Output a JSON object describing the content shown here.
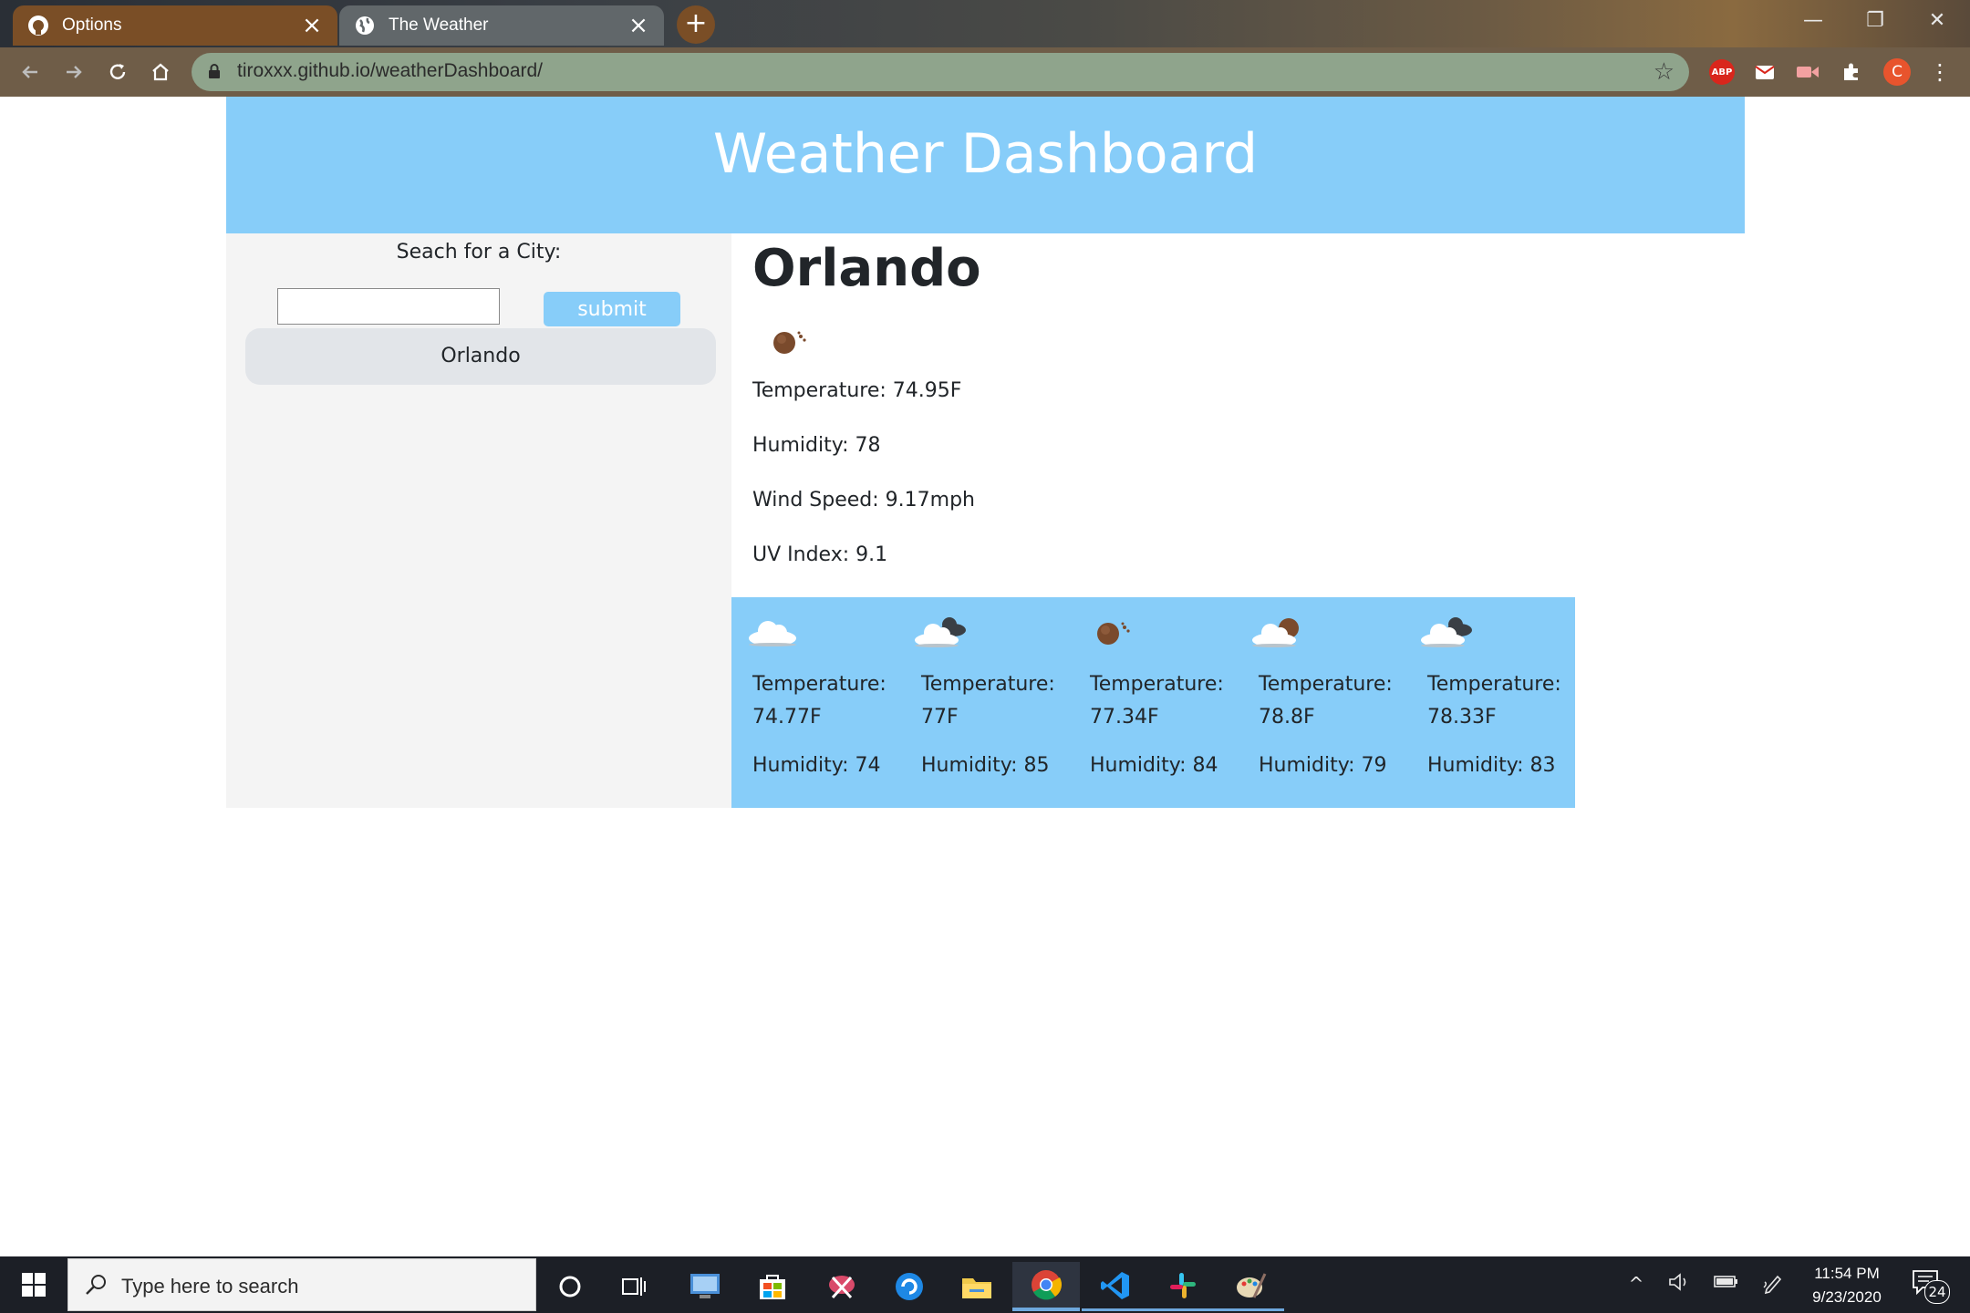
{
  "browser": {
    "tabs": [
      {
        "title": "Options",
        "icon": "github-icon",
        "active": false
      },
      {
        "title": "The Weather",
        "icon": "globe-icon",
        "active": true
      }
    ],
    "url": "tiroxxx.github.io/weatherDashboard/",
    "extensions": [
      "adblock-plus-icon",
      "mail-extension-icon",
      "video-extension-icon",
      "puzzle-icon"
    ],
    "profile_initial": "C"
  },
  "page": {
    "title": "Weather Dashboard",
    "search": {
      "label": "Seach for a City:",
      "value": "",
      "submit_label": "submit"
    },
    "history": [
      "Orlando"
    ],
    "current": {
      "city": "Orlando",
      "icon": "sun-icon",
      "temperature": "Temperature: 74.95F",
      "humidity": "Humidity: 78",
      "wind": "Wind Speed: 9.17mph",
      "uv": "UV Index: 9.1"
    },
    "forecast": [
      {
        "icon": "cloud-icon",
        "temp_label": "Temperature:",
        "temp_value": "74.77F",
        "humidity": "Humidity: 74"
      },
      {
        "icon": "broken-clouds-icon",
        "temp_label": "Temperature:",
        "temp_value": "77F",
        "humidity": "Humidity: 85"
      },
      {
        "icon": "sun-icon",
        "temp_label": "Temperature:",
        "temp_value": "77.34F",
        "humidity": "Humidity: 84"
      },
      {
        "icon": "partly-cloudy-icon",
        "temp_label": "Temperature:",
        "temp_value": "78.8F",
        "humidity": "Humidity: 79"
      },
      {
        "icon": "broken-clouds-icon",
        "temp_label": "Temperature:",
        "temp_value": "78.33F",
        "humidity": "Humidity: 83"
      }
    ],
    "colors": {
      "accent": "#87cdf9",
      "sidebar": "#f4f4f4",
      "history_button": "#e2e5e9"
    }
  },
  "taskbar": {
    "search_placeholder": "Type here to search",
    "time": "11:54 PM",
    "date": "9/23/2020",
    "notification_count": "24"
  }
}
